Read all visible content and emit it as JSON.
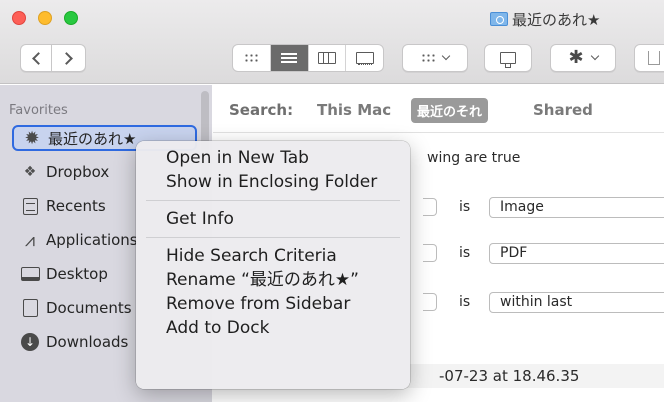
{
  "window": {
    "title": "最近のあれ★",
    "folder_icon": "smart-folder-icon"
  },
  "toolbar": {
    "back_icon": "chevron-left-icon",
    "forward_icon": "chevron-right-icon",
    "view_modes": [
      "icon-view",
      "list-view",
      "column-view",
      "gallery-view"
    ],
    "active_view": "list-view",
    "group_icon": "group-by-icon",
    "share_icon": "share-icon",
    "action_icon": "gear-icon",
    "upload_icon": "share-upload-icon"
  },
  "sidebar": {
    "header": "Favorites",
    "items": [
      {
        "label": "最近のあれ★",
        "icon": "gear-icon",
        "selected": true
      },
      {
        "label": "Dropbox",
        "icon": "dropbox-icon"
      },
      {
        "label": "Recents",
        "icon": "recents-icon"
      },
      {
        "label": "Applications",
        "icon": "applications-icon"
      },
      {
        "label": "Desktop",
        "icon": "desktop-icon"
      },
      {
        "label": "Documents",
        "icon": "document-icon"
      },
      {
        "label": "Downloads",
        "icon": "download-icon"
      }
    ]
  },
  "search": {
    "label": "Search:",
    "scopes": [
      "This Mac",
      "最近のそれ",
      "Shared"
    ],
    "active_scope": "最近のそれ"
  },
  "criteria": {
    "header_fragment": "wing are true",
    "rows": [
      {
        "operator": "is",
        "value": "Image"
      },
      {
        "operator": "is",
        "value": "PDF"
      },
      {
        "operator": "is",
        "value": "within last"
      }
    ]
  },
  "results": {
    "visible_file_fragment": "-07-23 at 18.46.35"
  },
  "context_menu": {
    "groups": [
      [
        "Open in New Tab",
        "Show in Enclosing Folder"
      ],
      [
        "Get Info"
      ],
      [
        "Hide Search Criteria",
        "Rename “最近のあれ★”",
        "Remove from Sidebar",
        "Add to Dock"
      ]
    ]
  },
  "colors": {
    "selection_border": "#2f6ae0",
    "sidebar_bg": "#d9d8e0",
    "scope_pill": "#9a9a9a"
  }
}
